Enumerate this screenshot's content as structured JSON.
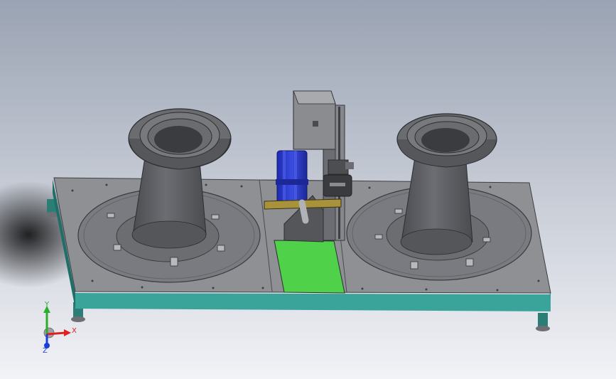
{
  "viewport": {
    "background_top": "#9aa3b3",
    "background_bottom": "#f2f3f7"
  },
  "colors": {
    "frame": "#3aa39a",
    "frame_dark": "#1f6e67",
    "plate": "#8f9094",
    "turntable": "#7a7b80",
    "cone": "#5e6064",
    "motor": "#2f3fd0",
    "guard": "#4fd24a",
    "bracket": "#a8923a"
  },
  "triad": {
    "x_label": "X",
    "y_label": "Y",
    "z_label": "Z",
    "x_color": "#e02020",
    "y_color": "#2cae2c",
    "z_color": "#1c3fd8"
  }
}
